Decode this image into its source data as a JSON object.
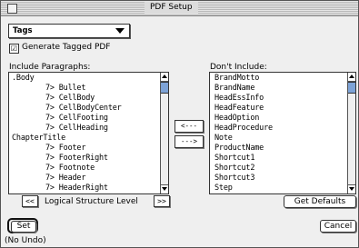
{
  "window": {
    "title": "PDF Setup"
  },
  "popup": {
    "selected": "Tags"
  },
  "generate_tagged": {
    "label": "Generate Tagged PDF",
    "checked": true,
    "mark": "☑"
  },
  "include": {
    "header": "Include Paragraphs:",
    "items": [
      {
        "label": ".Body",
        "indent": false
      },
      {
        "label": "7> Bullet",
        "indent": true
      },
      {
        "label": "7> CellBody",
        "indent": true
      },
      {
        "label": "7> CellBodyCenter",
        "indent": true
      },
      {
        "label": "7> CellFooting",
        "indent": true
      },
      {
        "label": "7> CellHeading",
        "indent": true
      },
      {
        "label": "ChapterTitle",
        "indent": false
      },
      {
        "label": "7> Footer",
        "indent": true
      },
      {
        "label": "7> FooterRight",
        "indent": true
      },
      {
        "label": "7> Footnote",
        "indent": true
      },
      {
        "label": "7> Header",
        "indent": true
      },
      {
        "label": "7> HeaderRight",
        "indent": true
      }
    ]
  },
  "exclude": {
    "header": "Don't Include:",
    "items": [
      "BrandMotto",
      "BrandName",
      "HeadEssInfo",
      "HeadFeature",
      "HeadOption",
      "HeadProcedure",
      "Note",
      "ProductName",
      "Shortcut1",
      "Shortcut2",
      "Shortcut3",
      "Step"
    ]
  },
  "move": {
    "to_include": "<---",
    "to_exclude": "--->"
  },
  "level": {
    "label": "Logical Structure Level",
    "decrease": "<<",
    "increase": ">>"
  },
  "buttons": {
    "get_defaults": "Get Defaults",
    "set": "Set",
    "cancel": "Cancel"
  },
  "status": {
    "undo": "(No Undo)"
  },
  "colors": {
    "scroll_thumb": "#7ea3d6"
  }
}
